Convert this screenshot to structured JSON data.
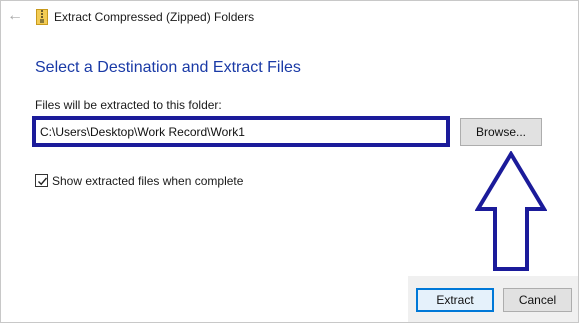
{
  "window": {
    "title": "Extract Compressed (Zipped) Folders",
    "back_icon": "back-arrow-icon",
    "app_icon": "zipped-folder-icon"
  },
  "dialog": {
    "heading": "Select a Destination and Extract Files",
    "folder_label": "Files will be extracted to this folder:",
    "path_value": "C:\\Users\\Desktop\\Work Record\\Work1",
    "browse_label": "Browse...",
    "show_files_label": "Show extracted files when complete",
    "show_files_checked": true
  },
  "footer": {
    "extract_label": "Extract",
    "cancel_label": "Cancel"
  },
  "colors": {
    "heading": "#1a3aa6",
    "highlight_border": "#1b1b9a",
    "annotation_arrow": "#1b1b9a",
    "primary_button_border": "#0078d7"
  }
}
